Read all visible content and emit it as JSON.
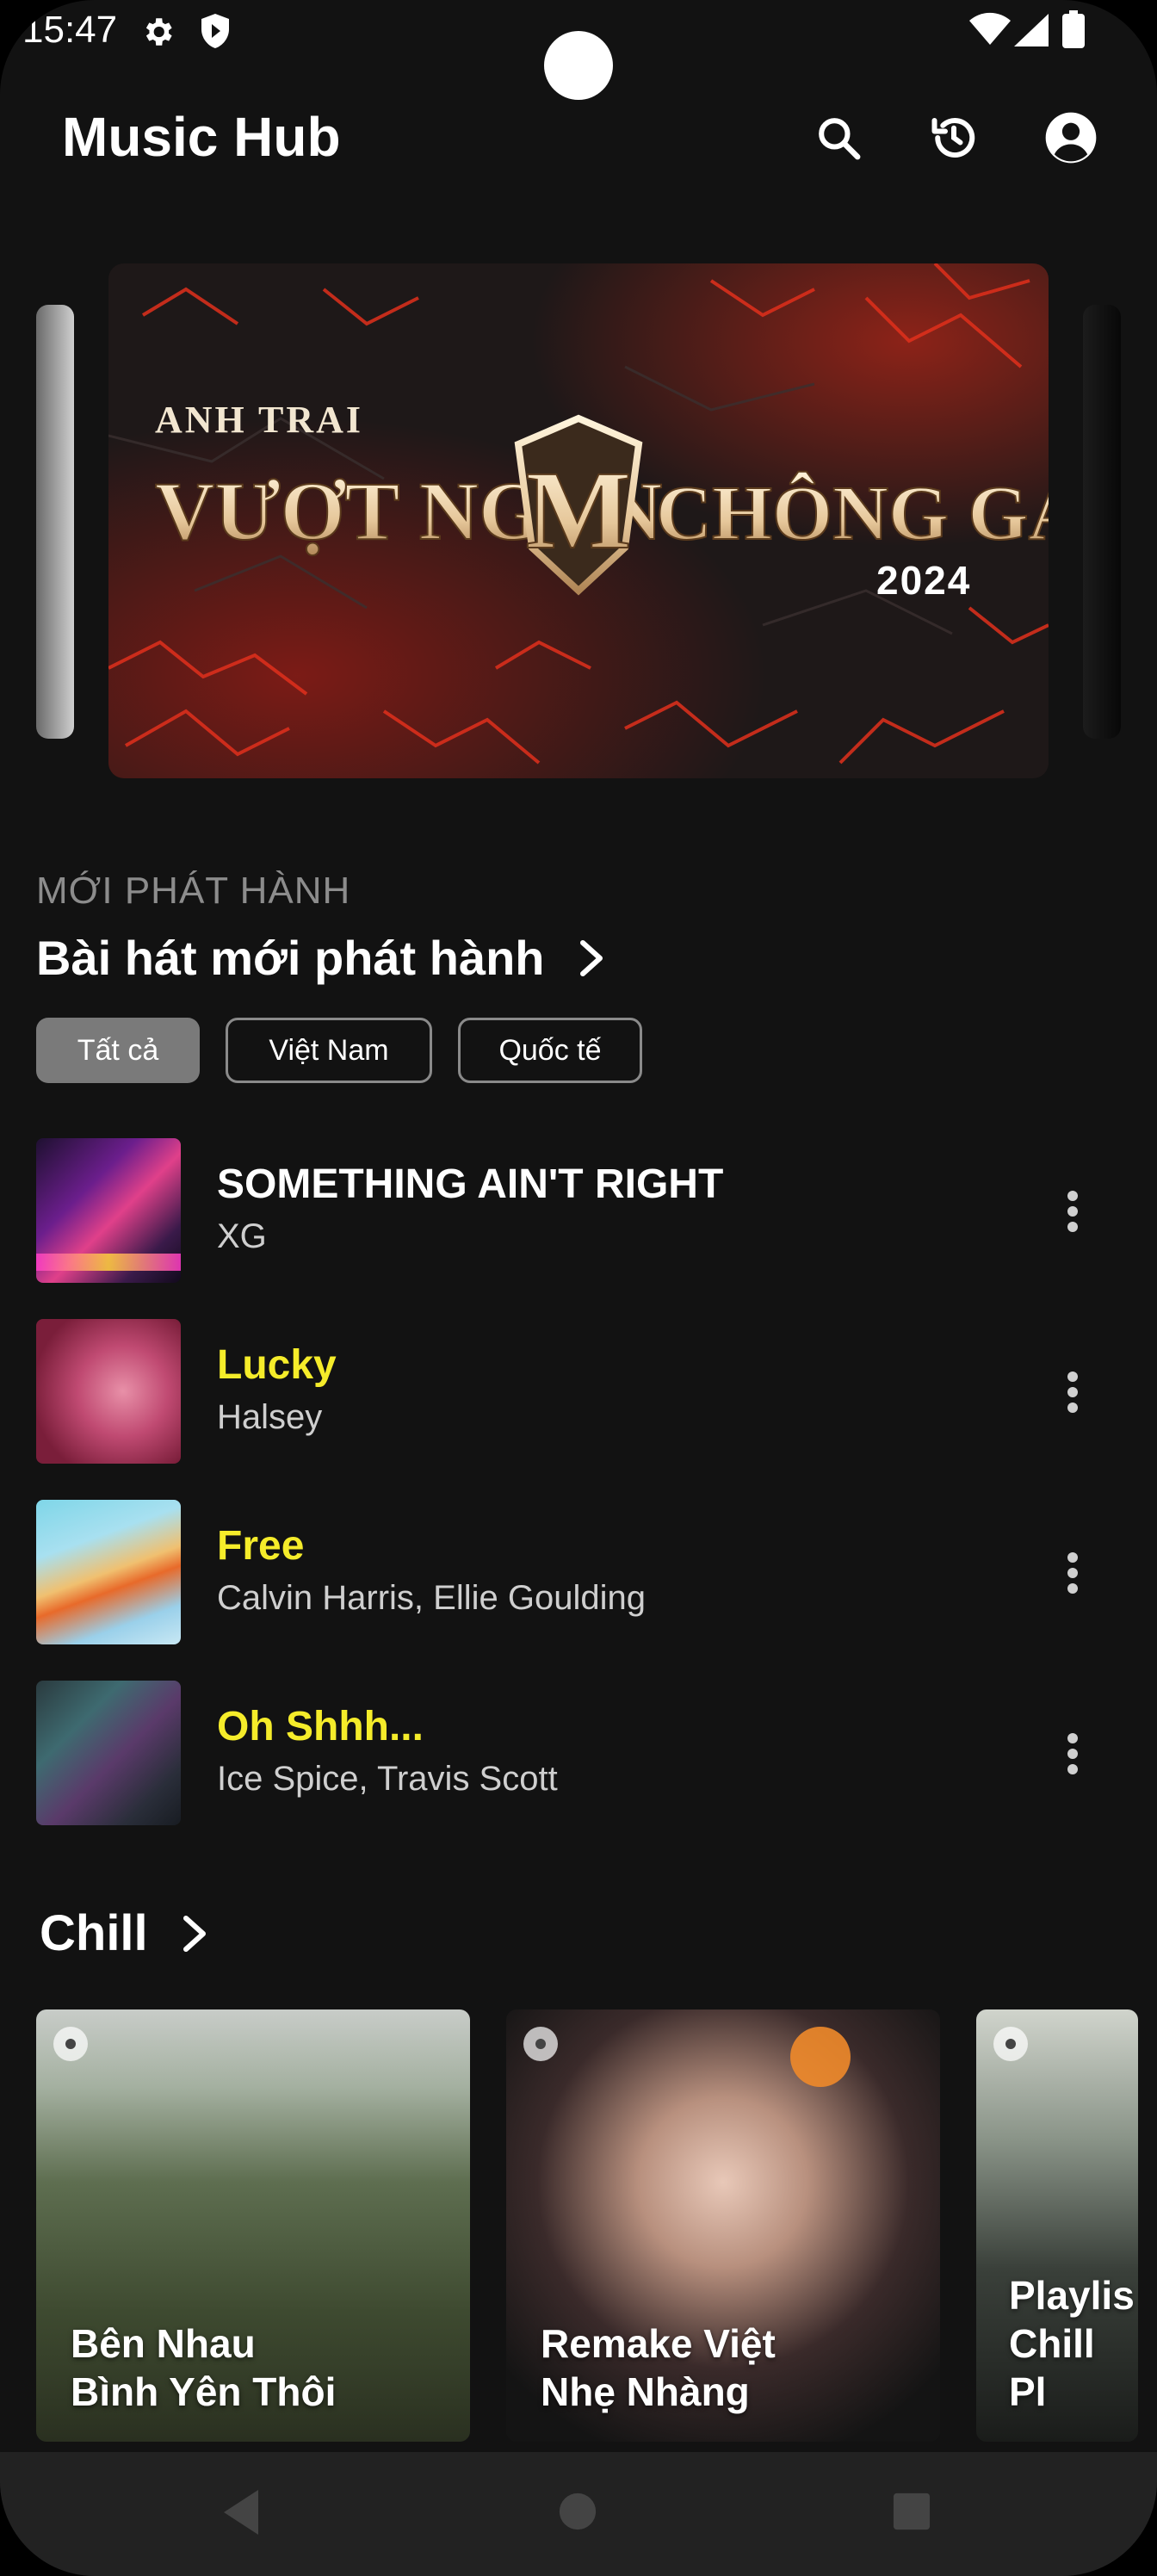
{
  "status_bar": {
    "time": "15:47"
  },
  "app_bar": {
    "title": "Music Hub",
    "icons": [
      "search-icon",
      "history-icon",
      "account-icon"
    ]
  },
  "banner": {
    "kicker": "ANH TRAI",
    "headline_left": "VƯỢT NGÀN",
    "monogram": "M",
    "headline_right": "CHÔNG GAI",
    "year": "2024"
  },
  "new_releases": {
    "kicker": "MỚI PHÁT HÀNH",
    "title": "Bài hát mới phát hành",
    "filters": [
      {
        "label": "Tất cả",
        "selected": true
      },
      {
        "label": "Việt Nam",
        "selected": false
      },
      {
        "label": "Quốc tế",
        "selected": false
      }
    ],
    "songs": [
      {
        "title": "SOMETHING AIN'T RIGHT",
        "artist": "XG",
        "title_color": "#ffffff"
      },
      {
        "title": "Lucky",
        "artist": "Halsey",
        "title_color": "#f5ec2a"
      },
      {
        "title": "Free",
        "artist": "Calvin Harris, Ellie Goulding",
        "title_color": "#f5ec2a"
      },
      {
        "title": "Oh Shhh...",
        "artist": "Ice Spice, Travis Scott",
        "title_color": "#f5ec2a"
      }
    ]
  },
  "chill": {
    "title": "Chill",
    "cards": [
      {
        "label": "Bên Nhau\nBình Yên Thôi"
      },
      {
        "label": "Remake Việt\nNhẹ Nhàng"
      },
      {
        "label": "Playlis\nChill Pl"
      }
    ]
  },
  "colors": {
    "background": "#121212",
    "accent_yellow": "#f5ec2a",
    "chip_active": "#7a7a7a",
    "nav_bar": "#222222"
  }
}
